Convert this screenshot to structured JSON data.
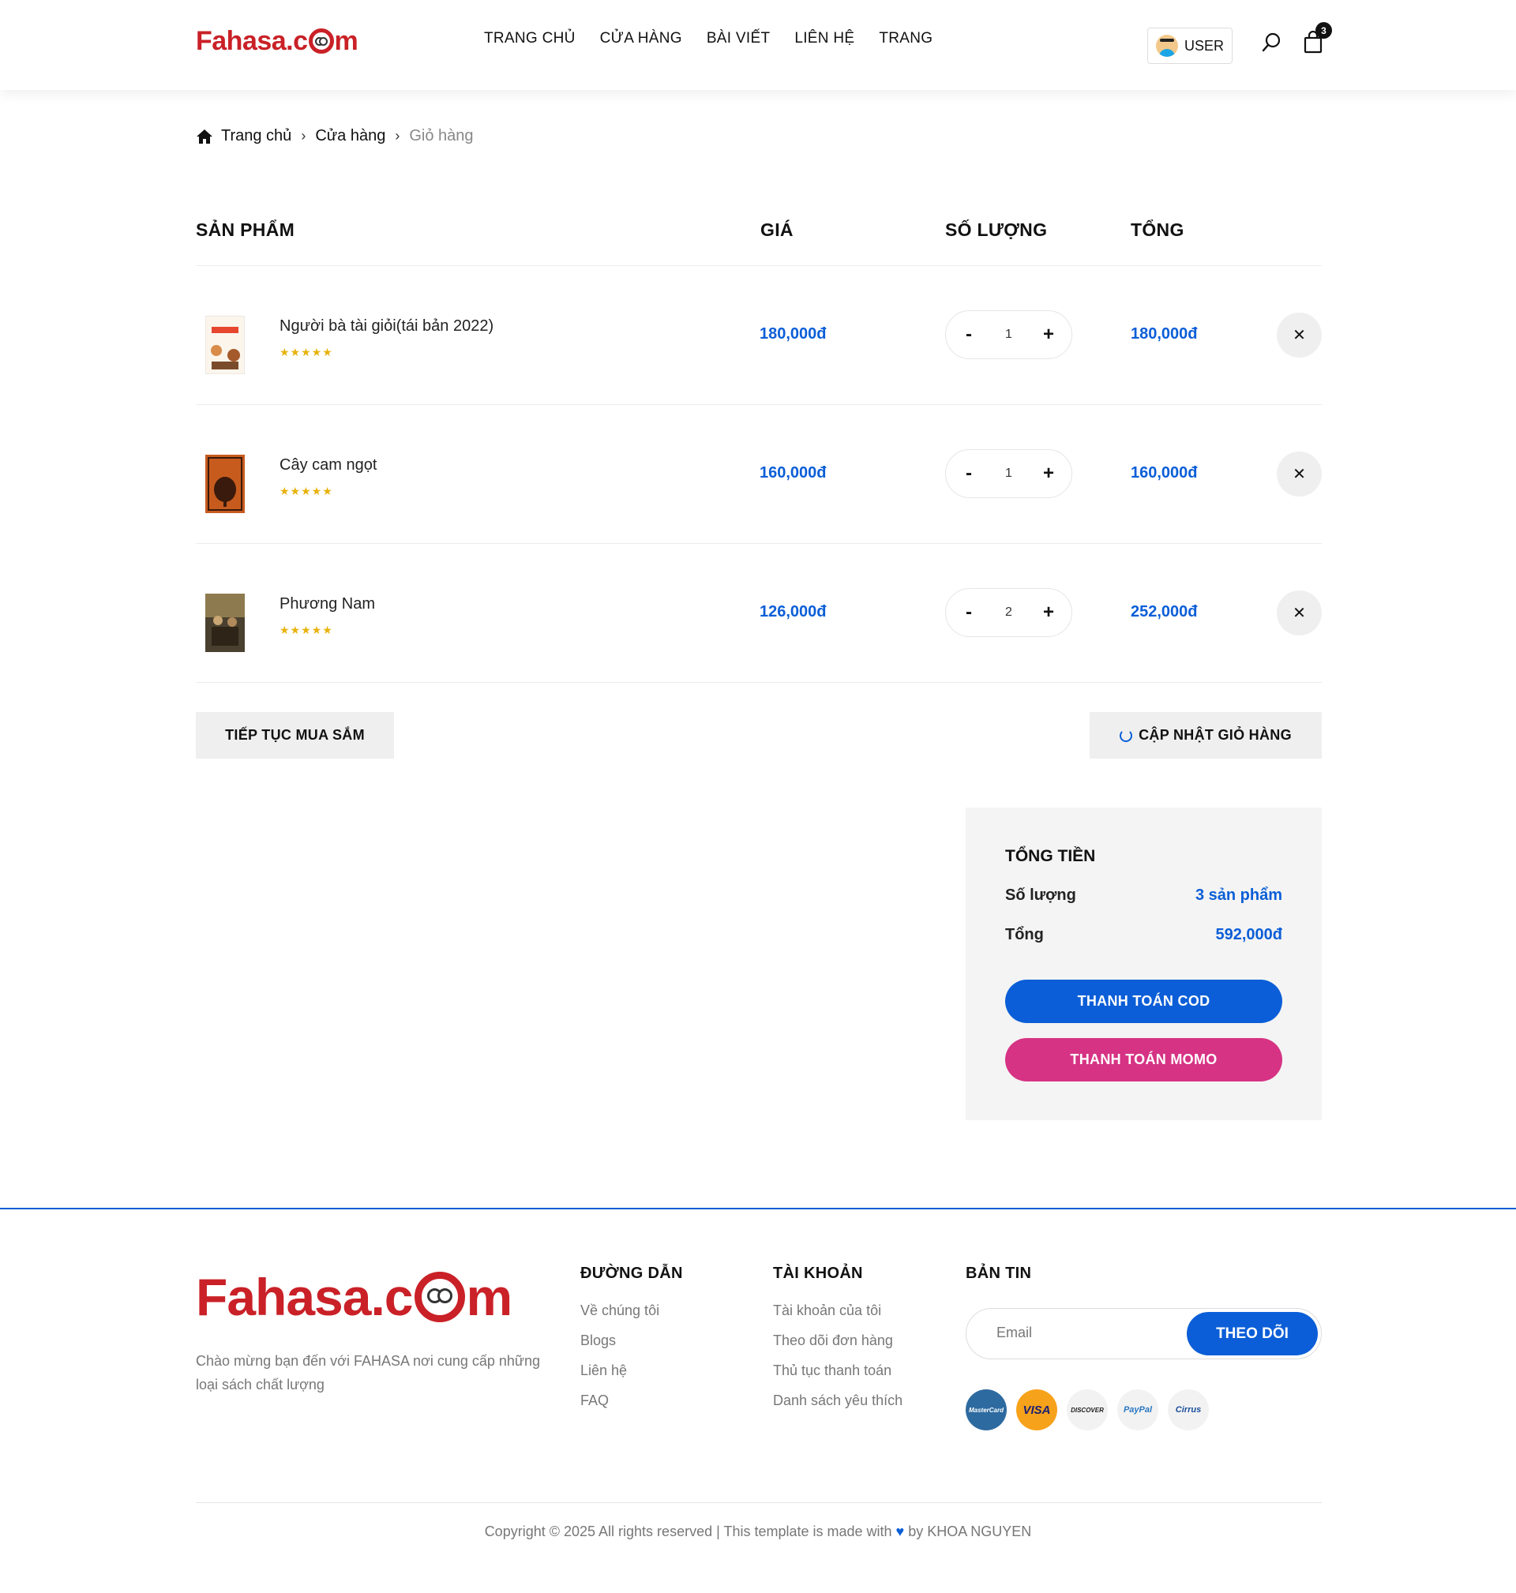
{
  "header": {
    "logo": "Fahasa.com",
    "nav": [
      "TRANG CHỦ",
      "CỬA HÀNG",
      "BÀI VIẾT",
      "LIÊN HỆ",
      "TRANG"
    ],
    "user_label": "USER",
    "cart_count": "3"
  },
  "breadcrumb": {
    "home": "Trang chủ",
    "shop": "Cửa hàng",
    "current": "Giỏ hàng"
  },
  "table": {
    "headers": {
      "product": "SẢN PHẨM",
      "price": "GIÁ",
      "qty": "SỐ LƯỢNG",
      "total": "TỔNG"
    },
    "rows": [
      {
        "name": "Người bà tài giỏi(tái bản 2022)",
        "stars": "★★★★★",
        "price": "180,000đ",
        "qty": "1",
        "total": "180,000đ",
        "minus": "-",
        "plus": "+",
        "remove": "✕"
      },
      {
        "name": "Cây cam ngọt",
        "stars": "★★★★★",
        "price": "160,000đ",
        "qty": "1",
        "total": "160,000đ",
        "minus": "-",
        "plus": "+",
        "remove": "✕"
      },
      {
        "name": "Phương Nam",
        "stars": "★★★★★",
        "price": "126,000đ",
        "qty": "2",
        "total": "252,000đ",
        "minus": "-",
        "plus": "+",
        "remove": "✕"
      }
    ]
  },
  "actions": {
    "continue": "TIẾP TỤC MUA SẮM",
    "update": "CẬP NHẬT GIỎ HÀNG"
  },
  "summary": {
    "title": "TỔNG TIỀN",
    "qty_label": "Số lượng",
    "qty_value": "3 sản phẩm",
    "total_label": "Tổng",
    "total_value": "592,000đ",
    "cod": "THANH TOÁN COD",
    "momo": "THANH TOÁN MOMO"
  },
  "footer": {
    "logo": "Fahasa.com",
    "about": "Chào mừng bạn đến với FAHASA nơi cung cấp những loại sách chất lượng",
    "links_title": "ĐƯỜNG DẪN",
    "links": [
      "Về chúng tôi",
      "Blogs",
      "Liên hệ",
      "FAQ"
    ],
    "account_title": "TÀI KHOẢN",
    "account": [
      "Tài khoản của tôi",
      "Theo dõi đơn hàng",
      "Thủ tục thanh toán",
      "Danh sách yêu thích"
    ],
    "news_title": "BẢN TIN",
    "email_placeholder": "Email",
    "subscribe": "THEO DÕI",
    "payment_icons": [
      "MasterCard",
      "VISA",
      "DISCOVER",
      "PayPal",
      "Cirrus"
    ],
    "copyright_pre": "Copyright © 2025 All rights reserved | This template is made with",
    "copyright_post": "by KHOA NGUYEN"
  },
  "colors": {
    "brand_red": "#c92127",
    "accent_blue": "#0b5ed7",
    "momo_pink": "#d63384"
  }
}
